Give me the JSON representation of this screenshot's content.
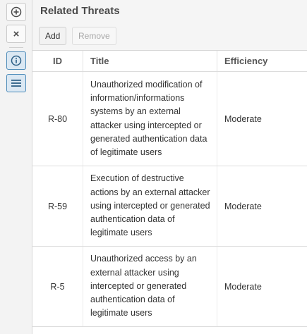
{
  "toolbar": {
    "items": [
      {
        "icon": "plus-circle-icon"
      },
      {
        "icon": "close-icon",
        "glyph": "×"
      },
      {
        "icon": "info-icon"
      },
      {
        "icon": "list-icon"
      }
    ]
  },
  "panel": {
    "title": "Related Threats",
    "add_label": "Add",
    "remove_label": "Remove"
  },
  "table": {
    "columns": [
      "ID",
      "Title",
      "Efficiency"
    ],
    "rows": [
      {
        "id": "R-80",
        "title": "Unauthorized modification of information/informations systems by an external attacker using intercepted or generated authentication data of legitimate users",
        "efficiency": "Moderate"
      },
      {
        "id": "R-59",
        "title": "Execution of destructive actions by an external attacker using intercepted or generated authentication data of legitimate users",
        "efficiency": "Moderate"
      },
      {
        "id": "R-5",
        "title": "Unauthorized access by an external attacker using intercepted or generated authentication data of legitimate users",
        "efficiency": "Moderate"
      }
    ]
  },
  "colors": {
    "accent": "#4b8ab8",
    "active_bg": "#dbe8f3"
  }
}
